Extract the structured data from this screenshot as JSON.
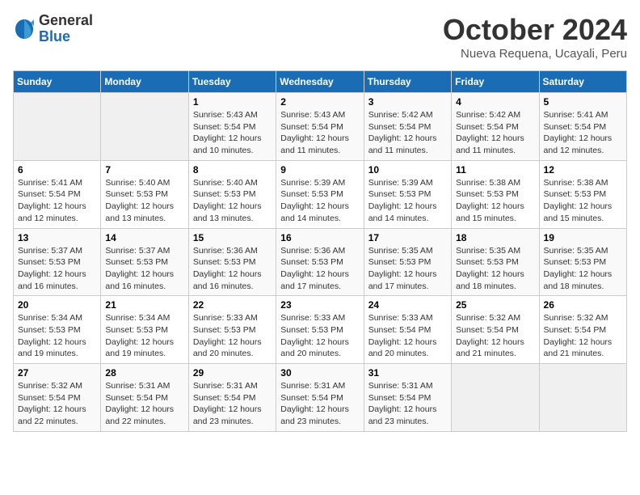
{
  "logo": {
    "general": "General",
    "blue": "Blue"
  },
  "title": "October 2024",
  "location": "Nueva Requena, Ucayali, Peru",
  "days_of_week": [
    "Sunday",
    "Monday",
    "Tuesday",
    "Wednesday",
    "Thursday",
    "Friday",
    "Saturday"
  ],
  "weeks": [
    [
      {
        "num": "",
        "info": ""
      },
      {
        "num": "",
        "info": ""
      },
      {
        "num": "1",
        "info": "Sunrise: 5:43 AM\nSunset: 5:54 PM\nDaylight: 12 hours\nand 10 minutes."
      },
      {
        "num": "2",
        "info": "Sunrise: 5:43 AM\nSunset: 5:54 PM\nDaylight: 12 hours\nand 11 minutes."
      },
      {
        "num": "3",
        "info": "Sunrise: 5:42 AM\nSunset: 5:54 PM\nDaylight: 12 hours\nand 11 minutes."
      },
      {
        "num": "4",
        "info": "Sunrise: 5:42 AM\nSunset: 5:54 PM\nDaylight: 12 hours\nand 11 minutes."
      },
      {
        "num": "5",
        "info": "Sunrise: 5:41 AM\nSunset: 5:54 PM\nDaylight: 12 hours\nand 12 minutes."
      }
    ],
    [
      {
        "num": "6",
        "info": "Sunrise: 5:41 AM\nSunset: 5:54 PM\nDaylight: 12 hours\nand 12 minutes."
      },
      {
        "num": "7",
        "info": "Sunrise: 5:40 AM\nSunset: 5:53 PM\nDaylight: 12 hours\nand 13 minutes."
      },
      {
        "num": "8",
        "info": "Sunrise: 5:40 AM\nSunset: 5:53 PM\nDaylight: 12 hours\nand 13 minutes."
      },
      {
        "num": "9",
        "info": "Sunrise: 5:39 AM\nSunset: 5:53 PM\nDaylight: 12 hours\nand 14 minutes."
      },
      {
        "num": "10",
        "info": "Sunrise: 5:39 AM\nSunset: 5:53 PM\nDaylight: 12 hours\nand 14 minutes."
      },
      {
        "num": "11",
        "info": "Sunrise: 5:38 AM\nSunset: 5:53 PM\nDaylight: 12 hours\nand 15 minutes."
      },
      {
        "num": "12",
        "info": "Sunrise: 5:38 AM\nSunset: 5:53 PM\nDaylight: 12 hours\nand 15 minutes."
      }
    ],
    [
      {
        "num": "13",
        "info": "Sunrise: 5:37 AM\nSunset: 5:53 PM\nDaylight: 12 hours\nand 16 minutes."
      },
      {
        "num": "14",
        "info": "Sunrise: 5:37 AM\nSunset: 5:53 PM\nDaylight: 12 hours\nand 16 minutes."
      },
      {
        "num": "15",
        "info": "Sunrise: 5:36 AM\nSunset: 5:53 PM\nDaylight: 12 hours\nand 16 minutes."
      },
      {
        "num": "16",
        "info": "Sunrise: 5:36 AM\nSunset: 5:53 PM\nDaylight: 12 hours\nand 17 minutes."
      },
      {
        "num": "17",
        "info": "Sunrise: 5:35 AM\nSunset: 5:53 PM\nDaylight: 12 hours\nand 17 minutes."
      },
      {
        "num": "18",
        "info": "Sunrise: 5:35 AM\nSunset: 5:53 PM\nDaylight: 12 hours\nand 18 minutes."
      },
      {
        "num": "19",
        "info": "Sunrise: 5:35 AM\nSunset: 5:53 PM\nDaylight: 12 hours\nand 18 minutes."
      }
    ],
    [
      {
        "num": "20",
        "info": "Sunrise: 5:34 AM\nSunset: 5:53 PM\nDaylight: 12 hours\nand 19 minutes."
      },
      {
        "num": "21",
        "info": "Sunrise: 5:34 AM\nSunset: 5:53 PM\nDaylight: 12 hours\nand 19 minutes."
      },
      {
        "num": "22",
        "info": "Sunrise: 5:33 AM\nSunset: 5:53 PM\nDaylight: 12 hours\nand 20 minutes."
      },
      {
        "num": "23",
        "info": "Sunrise: 5:33 AM\nSunset: 5:53 PM\nDaylight: 12 hours\nand 20 minutes."
      },
      {
        "num": "24",
        "info": "Sunrise: 5:33 AM\nSunset: 5:54 PM\nDaylight: 12 hours\nand 20 minutes."
      },
      {
        "num": "25",
        "info": "Sunrise: 5:32 AM\nSunset: 5:54 PM\nDaylight: 12 hours\nand 21 minutes."
      },
      {
        "num": "26",
        "info": "Sunrise: 5:32 AM\nSunset: 5:54 PM\nDaylight: 12 hours\nand 21 minutes."
      }
    ],
    [
      {
        "num": "27",
        "info": "Sunrise: 5:32 AM\nSunset: 5:54 PM\nDaylight: 12 hours\nand 22 minutes."
      },
      {
        "num": "28",
        "info": "Sunrise: 5:31 AM\nSunset: 5:54 PM\nDaylight: 12 hours\nand 22 minutes."
      },
      {
        "num": "29",
        "info": "Sunrise: 5:31 AM\nSunset: 5:54 PM\nDaylight: 12 hours\nand 23 minutes."
      },
      {
        "num": "30",
        "info": "Sunrise: 5:31 AM\nSunset: 5:54 PM\nDaylight: 12 hours\nand 23 minutes."
      },
      {
        "num": "31",
        "info": "Sunrise: 5:31 AM\nSunset: 5:54 PM\nDaylight: 12 hours\nand 23 minutes."
      },
      {
        "num": "",
        "info": ""
      },
      {
        "num": "",
        "info": ""
      }
    ]
  ]
}
